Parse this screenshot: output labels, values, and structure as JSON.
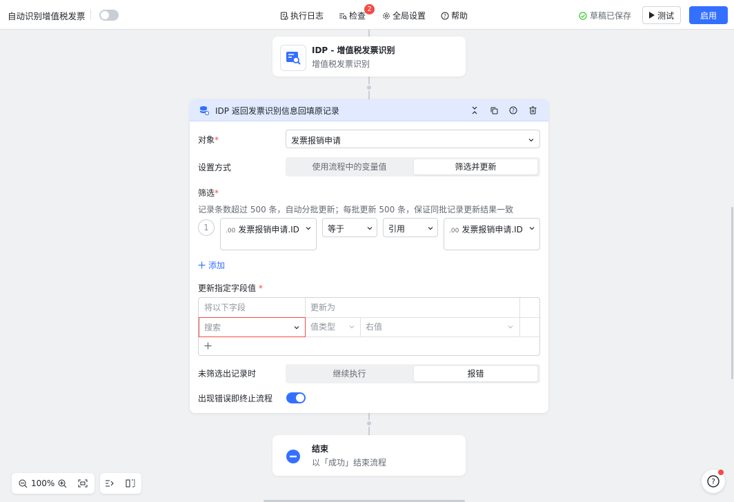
{
  "topbar": {
    "app_title": "自动识别增值税发票",
    "nav": [
      {
        "label": "执行日志",
        "icon": "log-icon"
      },
      {
        "label": "检查",
        "icon": "check-icon"
      },
      {
        "label": "全局设置",
        "icon": "gear-icon"
      },
      {
        "label": "帮助",
        "icon": "help-icon"
      }
    ],
    "check_badge": "2",
    "saved_status": "草稿已保存",
    "test_label": "测试",
    "enable_label": "启用"
  },
  "nodes": {
    "idp": {
      "title": "IDP - 增值税发票识别",
      "subtitle": "增值税发票识别"
    },
    "end": {
      "title": "结束",
      "subtitle": "以「成功」结束流程"
    }
  },
  "panel": {
    "title": "IDP 返回发票识别信息回填原记录",
    "object_label": "对象",
    "object_value": "发票报销申请",
    "mode_label": "设置方式",
    "mode_options": [
      "使用流程中的变量值",
      "筛选并更新"
    ],
    "filter_label": "筛选",
    "filter_hint": "记录条数超过 500 条，自动分批更新；每批更新 500 条，保证同批记录更新结果一致",
    "filter_row": {
      "index": "1",
      "field_tag": ".00",
      "field": "发票报销申请.ID",
      "operator": "等于",
      "value_type": "引用",
      "value_tag": ".00",
      "value": "发票报销申请.ID"
    },
    "add_label": "添加",
    "update_label": "更新指定字段值",
    "table_headers": [
      "将以下字段",
      "更新为"
    ],
    "row_field_placeholder": "搜索",
    "row_type_placeholder": "值类型",
    "row_value_placeholder": "右值",
    "no_record_label": "未筛选出记录时",
    "no_record_options": [
      "继续执行",
      "报错"
    ],
    "error_stop_label": "出现错误即终止流程",
    "error_stop_enabled": true
  },
  "zoom": {
    "level": "100%"
  },
  "colors": {
    "primary": "#3370ff",
    "danger": "#f54a45",
    "success": "#34c724",
    "panel_header": "#e1eaff"
  }
}
